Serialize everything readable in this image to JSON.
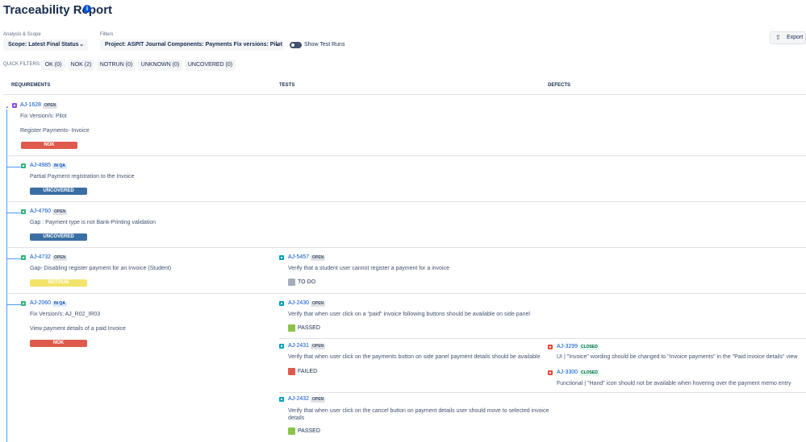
{
  "header": {
    "title": "Traceability Report",
    "info_icon": "info-icon"
  },
  "toolbar": {
    "analysis_label": "Analysis & Scope",
    "scope_value": "Scope: Latest Final Status",
    "filters_label": "Filters",
    "filter_value": "Project: ASPIT Journal Components: Payments Fix versions: Pilot",
    "show_test_runs": "Show Test Runs",
    "export": "Export"
  },
  "quick_filters": {
    "label": "QUICK FILTERS:",
    "items": [
      "OK (0)",
      "NOK (2)",
      "NOTRUN (0)",
      "UNKNOWN (0)",
      "UNCOVERED (0)"
    ]
  },
  "columns": {
    "requirements": "REQUIREMENTS",
    "tests": "TESTS",
    "defects": "DEFECTS"
  },
  "rows": [
    {
      "key": "AJ-1628",
      "badge": "OPEN",
      "fix": "Fix Version/s: Pilot",
      "summary": "Register Payments- Invoice",
      "status": "NOK"
    },
    {
      "key": "AJ-4985",
      "badge": "IN QA",
      "summary": "Partial Payment registration to the Invoice",
      "status": "UNCOVERED"
    },
    {
      "key": "AJ-4760",
      "badge": "OPEN",
      "summary": "Gap : Payment type is not Bank-Printing validation",
      "status": "UNCOVERED"
    },
    {
      "key": "AJ-4732",
      "badge": "OPEN",
      "summary": "Gap- Disabling register payment for an Invoice (Student)",
      "status": "NOTRUN"
    },
    {
      "key": "AJ-2060",
      "badge": "IN QA",
      "fix": "Fix Version/s: AJ_R02_IR03",
      "summary": "View payment details of a paid Invoice",
      "status": "NOK"
    }
  ],
  "tests": [
    {
      "key": "AJ-5457",
      "badge": "OPEN",
      "summary": "Verify that a student user cannot register a payment for a invoice",
      "status": "TO DO",
      "color": "#a5adba"
    },
    {
      "key": "AJ-2430",
      "badge": "OPEN",
      "summary": "Verify that when user click on a \"paid\" invoice following buttons should be available on side panel",
      "status": "PASSED",
      "color": "#8bc34a"
    },
    {
      "key": "AJ-2431",
      "badge": "OPEN",
      "summary": "Verify that when user click on the payments button on side panel payment details should be available",
      "status": "FAILED",
      "color": "#de5a4c"
    },
    {
      "key": "AJ-2432",
      "badge": "OPEN",
      "summary_1": "Verify that when user click on the cancel button on payment details user should move to selected invoice",
      "summary_2": "details",
      "status": "PASSED",
      "color": "#8bc34a"
    }
  ],
  "defects": [
    {
      "key": "AJ-3299",
      "badge": "CLOSED",
      "summary": "UI | \"Invoice\" wording should be changed to \"Invoice payments\" in the \"Paid invoice details\" view"
    },
    {
      "key": "AJ-3300",
      "badge": "CLOSED",
      "summary": "Functional | \"Hand\" icon should not be available when hovering over the payment memo entry"
    }
  ]
}
